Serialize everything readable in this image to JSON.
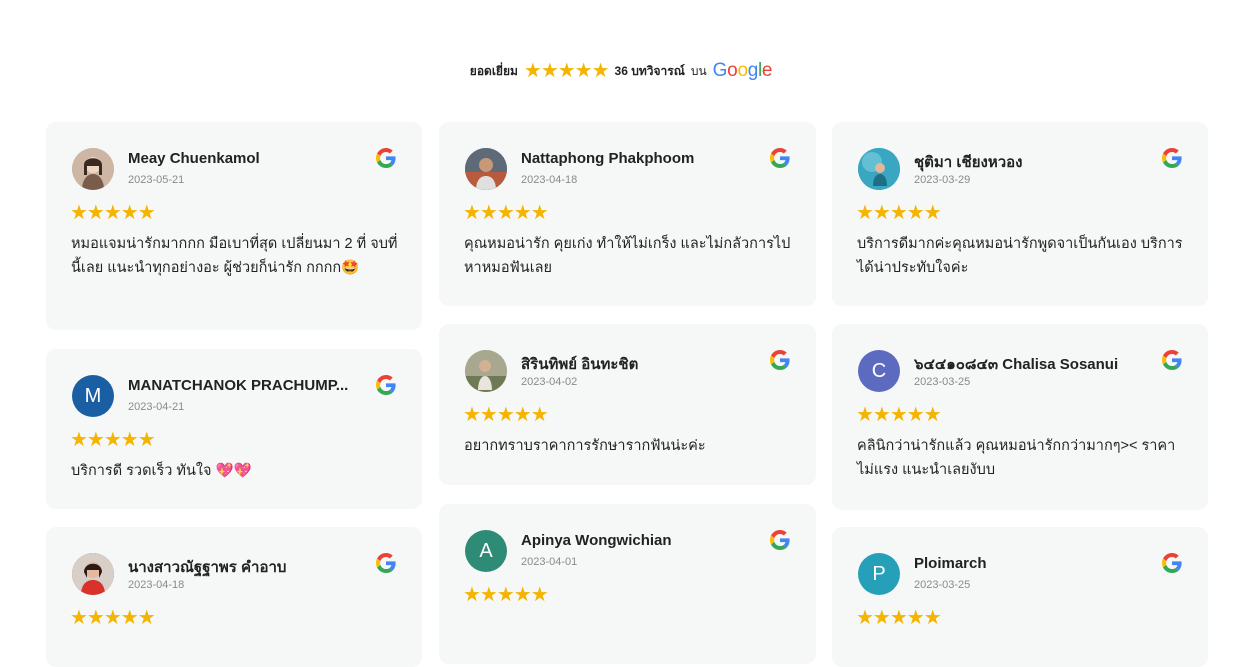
{
  "summary": {
    "rating_label": "ยอดเยี่ยม",
    "rating_value": 5,
    "stars": "★★★★★",
    "count_text": "36 บทวิจารณ์",
    "on_text": "บน",
    "brand": [
      "G",
      "o",
      "o",
      "g",
      "l",
      "e"
    ],
    "brand_colors": [
      "#4285F4",
      "#EA4335",
      "#FBBC05",
      "#4285F4",
      "#34A853",
      "#EA4335"
    ]
  },
  "colors": {
    "star": "#f4b400",
    "card_bg": "#f6f7f7"
  },
  "reviews": [
    {
      "name": "Meay Chuenkamol",
      "date": "2023-05-21",
      "stars": "★★★★★",
      "rating": 5,
      "text": "หมอแจมน่ารักมากกก มือเบาที่สุด เปลี่ยนมา 2 ที่ จบที่นี้เลย แนะนำทุกอย่างอะ ผู้ช่วยก็น่ารัก กกกก🤩",
      "avatar": "photo",
      "source_icon": "google-icon"
    },
    {
      "name": "MANATCHANOK PRACHUMP...",
      "date": "2023-04-21",
      "stars": "★★★★★",
      "rating": 5,
      "text": "บริการดี รวดเร็ว ทันใจ 💖💖",
      "avatar": "M",
      "avatar_color": "#1a5fa3",
      "source_icon": "google-icon"
    },
    {
      "name": "นางสาวณัฐฐาพร คำอาบ",
      "date": "2023-04-18",
      "stars": "★★★★★",
      "rating": 5,
      "avatar": "photo",
      "source_icon": "google-icon"
    },
    {
      "name": "Nattaphong Phakphoom",
      "date": "2023-04-18",
      "stars": "★★★★★",
      "rating": 5,
      "text": "คุณหมอน่ารัก คุยเก่ง ทำให้ไม่เกร็ง และไม่กลัวการไปหาหมอฟันเลย",
      "avatar": "photo",
      "source_icon": "google-icon"
    },
    {
      "name": "สิรินทิพย์ อินทะชิต",
      "date": "2023-04-02",
      "stars": "★★★★★",
      "rating": 5,
      "text": "อยากทราบราคาการรักษารากฟันน่ะค่ะ",
      "avatar": "photo",
      "source_icon": "google-icon"
    },
    {
      "name": "Apinya Wongwichian",
      "date": "2023-04-01",
      "stars": "★★★★★",
      "rating": 5,
      "avatar": "A",
      "avatar_color": "#2e8b76",
      "source_icon": "google-icon"
    },
    {
      "name": "ชุติมา เชียงหวอง",
      "date": "2023-03-29",
      "stars": "★★★★★",
      "rating": 5,
      "text": "บริการดีมากค่ะคุณหมอน่ารักพูดจาเป็นกันเอง บริการได้น่าประทับใจค่ะ",
      "avatar": "photo",
      "source_icon": "google-icon"
    },
    {
      "name": "๖๔๔๑๐๘๔๓ Chalisa Sosanui",
      "date": "2023-03-25",
      "stars": "★★★★★",
      "rating": 5,
      "text": "คลินิกว่าน่ารักแล้ว คุณหมอน่ารักกว่ามากๆ>< ราคาไม่แรง แนะนำเลยงับบ",
      "avatar": "C",
      "avatar_color": "#5c6bc0",
      "source_icon": "google-icon"
    },
    {
      "name": "Ploimarch",
      "date": "2023-03-25",
      "stars": "★★★★★",
      "rating": 5,
      "avatar": "P",
      "avatar_color": "#26a0b8",
      "source_icon": "google-icon"
    }
  ]
}
